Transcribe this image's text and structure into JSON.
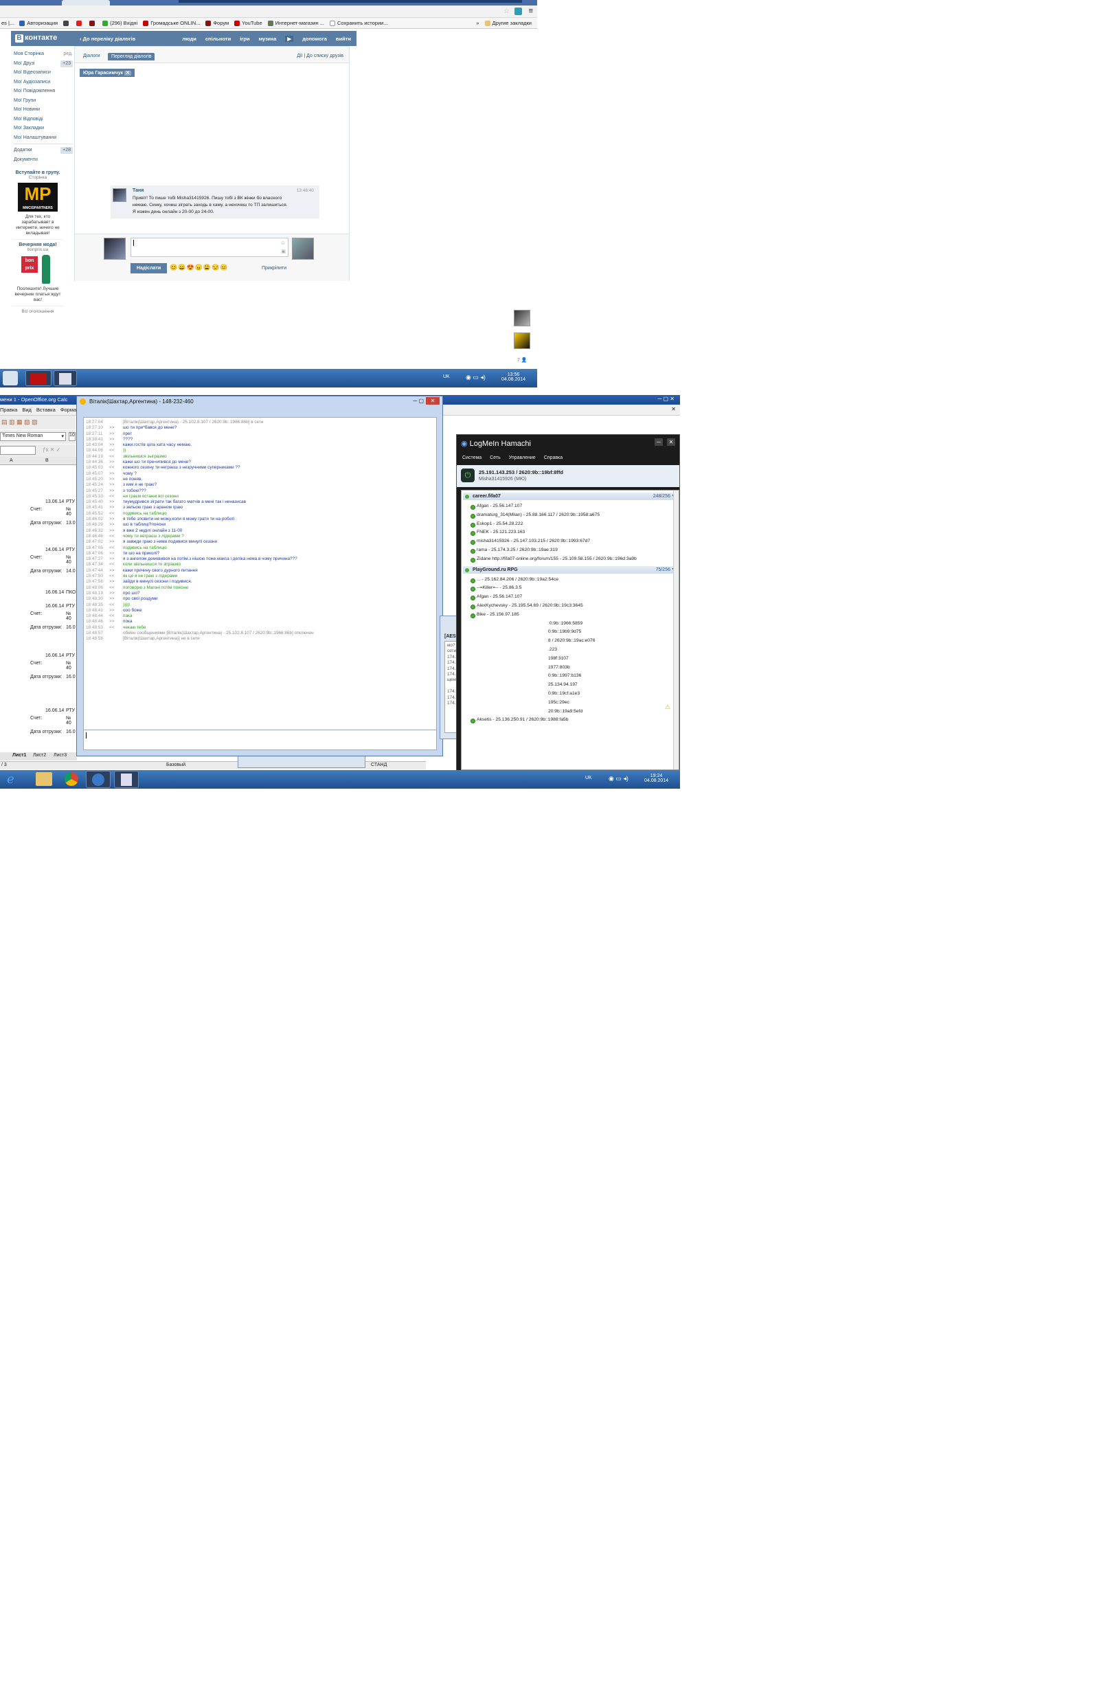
{
  "browser": {
    "bookmarks": [
      "Авторизация",
      "(296) Вхідні",
      "Громадське ONLIN...",
      "Форум",
      "YouTube",
      "Интернет-магазин ...",
      "Сохранить истории..."
    ],
    "other_bookmarks": "Другие закладки",
    "chevron": "»"
  },
  "vk": {
    "logo_letter": "В",
    "logo_text": "контакте",
    "back_link": "До переліку діалогів",
    "nav": [
      "люди",
      "спільноти",
      "ігри",
      "музика",
      "допомога",
      "вийти"
    ],
    "sidebar": [
      {
        "label": "Моя Сторінка",
        "badge": "ред."
      },
      {
        "label": "Мої Друзі",
        "badge": "+23"
      },
      {
        "label": "Мої Відеозаписи",
        "badge": ""
      },
      {
        "label": "Мої Аудіозаписи",
        "badge": ""
      },
      {
        "label": "Мої Повідомлення",
        "badge": ""
      },
      {
        "label": "Мої Групи",
        "badge": ""
      },
      {
        "label": "Мої Новини",
        "badge": ""
      },
      {
        "label": "Мої Відповіді",
        "badge": ""
      },
      {
        "label": "Мої Закладки",
        "badge": ""
      },
      {
        "label": "Мої Налаштування",
        "badge": ""
      }
    ],
    "sidebar2": [
      {
        "label": "Додатки",
        "badge": "+28"
      },
      {
        "label": "Документи",
        "badge": ""
      }
    ],
    "ad1": {
      "title": "Вступайте в групу.",
      "sub": "Сторінка",
      "logo": "MP",
      "logo_sub": "MMCISPARTNERS",
      "text": "Для тех, кто зарабатывает в интернете, ничего не вкладывая!"
    },
    "ad2": {
      "title": "Вечерняя мода!",
      "sub": "bonprix.ua",
      "logo": "bon prix",
      "text": "Поспешите! Лучшие вечерние платья ждут вас!"
    },
    "all_ads": "Всі оголошення",
    "tabs": {
      "dialogs": "Діалоги",
      "view": "Перегляд діалогів",
      "actions": "Дії",
      "to_friends": "До списку друзів"
    },
    "peer": "Юра Гарасимчук",
    "message": {
      "author": "Таня",
      "time": "13:46:40",
      "text": "Привіт! То пише тобі Misha31415926. Пишу тобі з ВК жінки бо власного немаю. Синку, хочеш зіграть заходь в хаму, а нехочеш то ТП залишиться. Я кожен день онлайн з 20-00 до 24-00."
    },
    "send_button": "Надіслати",
    "attach": "Прикріпити",
    "emojis": [
      "😊",
      "😄",
      "😍",
      "😠",
      "😩",
      "😒",
      "😐"
    ],
    "online_count": "7"
  },
  "taskbar_top": {
    "lang": "UK",
    "time": "13:56",
    "date": "04.08.2014"
  },
  "calc": {
    "title": "мени 1 - OpenOffice.org Calc",
    "menu": [
      "Правка",
      "Вид",
      "Вставка",
      "Форма"
    ],
    "font": "Times New Roman",
    "font_size": "10",
    "col_a": "A",
    "col_b": "B",
    "rows": [
      {
        "date": "13.06.14",
        "a": "РТУ",
        "label1": "Счет:",
        "no": "№ 40",
        "label2": "Дата отгрузки:",
        "d2": "13.0"
      },
      {
        "date": "14.06.14",
        "a": "РТУ",
        "label1": "Счет:",
        "no": "№ 40",
        "label2": "Дата отгрузки:",
        "d2": "14.0"
      },
      {
        "date": "16.06.14",
        "a": "ПКО",
        "label1": "",
        "no": "",
        "label2": "",
        "d2": ""
      },
      {
        "date": "16.06.14",
        "a": "РТУ",
        "label1": "Счет:",
        "no": "№ 40",
        "label2": "Дата отгрузки:",
        "d2": "16.0"
      },
      {
        "date": "16.06.14",
        "a": "РТУ",
        "label1": "Счет:",
        "no": "№ 40",
        "label2": "Дата отгрузки:",
        "d2": "16.0"
      },
      {
        "date": "16.06.14",
        "a": "РТУ",
        "label1": "Счет:",
        "no": "№ 40",
        "label2": "Дата отгрузки:",
        "d2": "16.0"
      }
    ],
    "sheets": [
      "Лист1",
      "Лист2",
      "Лист3"
    ],
    "status_page": "/ 3",
    "status_style": "Базовый",
    "status_mode": "СТАНД"
  },
  "chat": {
    "title": "Віталік(Шахтар,Аргентина) - 148-232-460",
    "lines": [
      {
        "t": "18:27:04",
        "d": "",
        "k": "sys",
        "x": "[Віталік(Шахтар,Аргентина) - 25.102.8.107 / 2620:9b::1966:86b] в сети"
      },
      {
        "t": "18:27:10",
        "d": ">>",
        "k": "in",
        "x": "шо ти при*бався до мене?"
      },
      {
        "t": "18:27:11",
        "d": ">>",
        "k": "in",
        "x": "прет"
      },
      {
        "t": "18:38:41",
        "d": ">>",
        "k": "in",
        "x": "????"
      },
      {
        "t": "18:43:04",
        "d": ">>",
        "k": "in",
        "x": "кажи.гостів ціла хата часу немаю."
      },
      {
        "t": "18:44:06",
        "d": "<<",
        "k": "out",
        "x": "))"
      },
      {
        "t": "18:44:19",
        "d": "<<",
        "k": "out",
        "x": "звільнишся зыграэмо"
      },
      {
        "t": "18:44:36",
        "d": ">>",
        "k": "in",
        "x": "кажи шо ти пре»ипився до мене?"
      },
      {
        "t": "18:45:03",
        "d": "<<",
        "k": "in",
        "x": "кожного сезону ти неграєш з незручними суперниками ??"
      },
      {
        "t": "18:45:07",
        "d": ">>",
        "k": "in",
        "x": "чому ?"
      },
      {
        "t": "18:45:20",
        "d": ">>",
        "k": "in",
        "x": "не поняв."
      },
      {
        "t": "18:45:24",
        "d": ">>",
        "k": "in",
        "x": "з ким я не граю?"
      },
      {
        "t": "18:45:27",
        "d": ">>",
        "k": "in",
        "x": "з тобою???"
      },
      {
        "t": "18:45:33",
        "d": "<<",
        "k": "out",
        "x": "ни граєм останні всі сезони"
      },
      {
        "t": "18:45:40",
        "d": ">>",
        "k": "in",
        "x": "тиумудрився зіграти так багато матчів а мені так і неназисав"
      },
      {
        "t": "18:45:41",
        "d": ">>",
        "k": "in",
        "x": "з зельою граю з араном граю"
      },
      {
        "t": "18:45:52",
        "d": "<<",
        "k": "out",
        "x": "подивись на таблицю"
      },
      {
        "t": "18:46:02",
        "d": ">>",
        "k": "in",
        "x": "я тебе зловити не можу.коли я  можу грати ти на роботі ."
      },
      {
        "t": "18:46:29",
        "d": ">>",
        "k": "in",
        "x": "шо в таблиці?поясни"
      },
      {
        "t": "18:46:32",
        "d": ">>",
        "k": "in",
        "x": "я вже 2 неділі онлайн з 11-00"
      },
      {
        "t": "18:46:46",
        "d": "<<",
        "k": "out",
        "x": "чому ти неграєш з лідерами ?"
      },
      {
        "t": "18:47:02",
        "d": ">>",
        "k": "in",
        "x": "я завжди граю з ними.подивися минулі сезони"
      },
      {
        "t": "18:47:05",
        "d": "<<",
        "k": "out",
        "x": "подивись на таблицю"
      },
      {
        "t": "18:47:06",
        "d": ">>",
        "k": "in",
        "x": "ти шо на приколі?"
      },
      {
        "t": "18:47:27",
        "d": ">>",
        "k": "in",
        "x": "я з ангелом домовився на потім.з нішою тоже.макса і деліка нема.в чому причина???"
      },
      {
        "t": "18:47:34",
        "d": "<<",
        "k": "out",
        "x": "коли звільнишся то зіграємо"
      },
      {
        "t": "18:47:44",
        "d": ">>",
        "k": "in",
        "x": "кажи причину свого дурного питання"
      },
      {
        "t": "18:47:50",
        "d": "<<",
        "k": "out",
        "x": "як це я не граю з лідерами"
      },
      {
        "t": "18:47:56",
        "d": ">>",
        "k": "in",
        "x": "зайди в минулі сезони і подивися."
      },
      {
        "t": "18:48:06",
        "d": "<<",
        "k": "out",
        "x": "поговорю з Магоні потім поясню"
      },
      {
        "t": "18:48:19",
        "d": ">>",
        "k": "in",
        "x": "про шо?"
      },
      {
        "t": "18:48:30",
        "d": ">>",
        "k": "in",
        "x": "про свої роздуми"
      },
      {
        "t": "18:48:35",
        "d": "<<",
        "k": "out",
        "x": "))))\\"
      },
      {
        "t": "18:48:41",
        "d": ">>",
        "k": "in",
        "x": "ооо боже"
      },
      {
        "t": "18:48:44",
        "d": "<<",
        "k": "out",
        "x": "пака"
      },
      {
        "t": "18:48:46",
        "d": ">>",
        "k": "in",
        "x": "пока"
      },
      {
        "t": "18:48:53",
        "d": "<<",
        "k": "out",
        "x": "чекаю тебе"
      },
      {
        "t": "18:48:57",
        "d": "",
        "k": "sys",
        "x": "обмен сообщениями [Віталік(Шахтар,Аргентина) - 25.102.8.107 / 2620:9b::1966:86b] отключен"
      },
      {
        "t": "18:48:58",
        "d": "",
        "k": "sys",
        "x": "[Віталік(Шахтар,Аргентина)] не в сети"
      }
    ]
  },
  "hamachi": {
    "title": "LogMeIn Hamachi",
    "menu": [
      "Система",
      "Сеть",
      "Управление",
      "Справка"
    ],
    "ip": "25.191.143.253 / 2620:9b::19bf:8ffd",
    "nick": "Misha31415926 (МЮ)",
    "groups": [
      {
        "name": "career.fifa07",
        "count": "248/256",
        "peers": [
          "Afgan - 25.56.147.107",
          "dramaturg_314(Milan) - 25.88.166.117 / 2620:9b::1958:a675",
          "Eskop1 - 25.54.28.222",
          "FNEK - 25.121.223.163",
          "misha31415926 - 25.147.103.215 / 2620:9b::1993:67d7",
          "rama - 25.174.3.25 / 2620:9b::19ae:319",
          "Zidane http://fifa07-online.org/forum/155 - 25.109.58.155 / 2620:9b::196d:3a9b"
        ]
      },
      {
        "name": "PlayGround.ru RPG",
        "count": "75/256",
        "peers": [
          "... - 25.162.84.206 / 2620:9b::19a2:54ce",
          "--=Killer=-- - 25.86.3.5",
          "Afgan - 25.56.147.107",
          "AlexKychevsky - 25.195.54.69 / 2620:9b::19c3:3645",
          "Bike - 25.156.97.185"
        ]
      }
    ],
    "tail_peers": [
      ":0:9b::1966:5859",
      "0:9b::19b9:9d75",
      "8 / 2620:9b::19ac:e076",
      ".223",
      "198f:3107",
      "1977:803b",
      "0:9b::1997:b136",
      "25.134.94.197",
      "0:9b::19cf:a1e3",
      "195c:29ec",
      "20:9b::19a9:5efd"
    ],
    "last_peer": "Aksetis - 25.136.250.91 / 2620:9b::1988:fa5b"
  },
  "popup": {
    "title": "[AES-256]",
    "lines": [
      "мо?",
      "сети",
      "174.3.25 / 2620:9b::19ae:319] в сети",
      "174.3.25 / 2620:9b::19ae:319] не в сети",
      "174.3.25 / 2620:9b::19ae:319] в сети",
      "174.3.25 / 2620:9b::19ae:319] не в сети",
      "щениями [rama - 25.174.3.25 /",
      "",
      "174.3.25 / 2620:9b::19ae:319] в сети",
      "174.3.25 / 2620:9b::19ae:319] не в сети",
      "174.3.25 / 2620:9b::19ae:319] в сети"
    ]
  },
  "taskbar_bottom": {
    "lang": "UK",
    "time": "19:24",
    "date": "04.08.2014"
  }
}
